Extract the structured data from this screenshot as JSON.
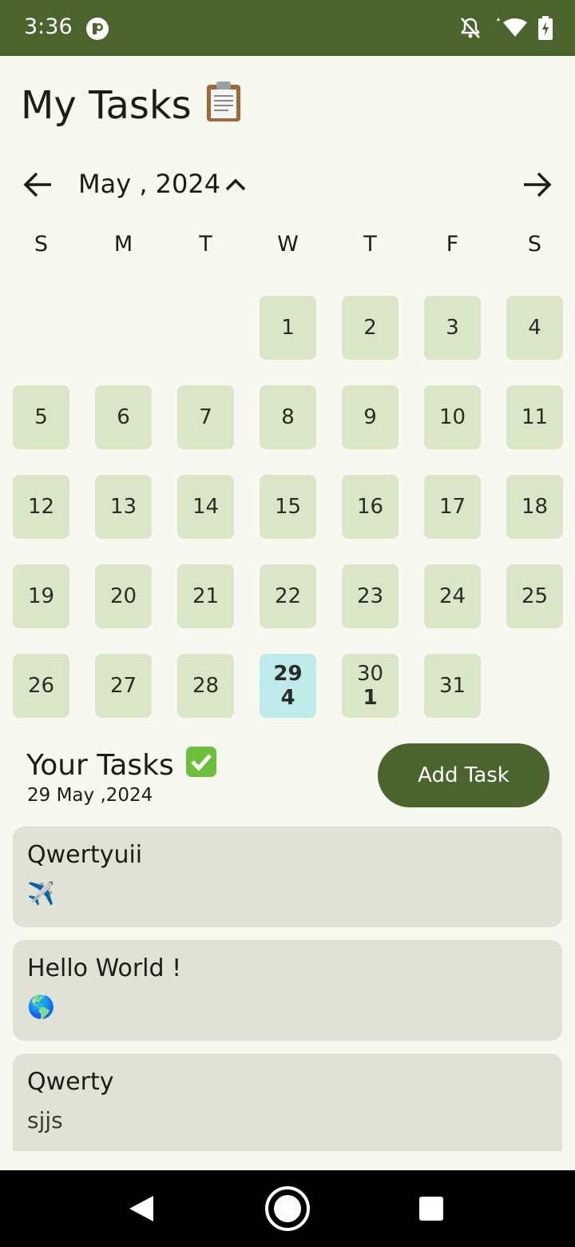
{
  "status_bar": {
    "time": "3:36"
  },
  "header": {
    "title": "My Tasks",
    "title_icon": "clipboard-icon"
  },
  "calendar": {
    "month_label": "May , 2024",
    "weekdays": [
      "S",
      "M",
      "T",
      "W",
      "T",
      "F",
      "S"
    ],
    "days": [
      {
        "day": "1"
      },
      {
        "day": "2"
      },
      {
        "day": "3"
      },
      {
        "day": "4"
      },
      {
        "day": "5"
      },
      {
        "day": "6"
      },
      {
        "day": "7"
      },
      {
        "day": "8"
      },
      {
        "day": "9"
      },
      {
        "day": "10"
      },
      {
        "day": "11"
      },
      {
        "day": "12"
      },
      {
        "day": "13"
      },
      {
        "day": "14"
      },
      {
        "day": "15"
      },
      {
        "day": "16"
      },
      {
        "day": "17"
      },
      {
        "day": "18"
      },
      {
        "day": "19"
      },
      {
        "day": "20"
      },
      {
        "day": "21"
      },
      {
        "day": "22"
      },
      {
        "day": "23"
      },
      {
        "day": "24"
      },
      {
        "day": "25"
      },
      {
        "day": "26"
      },
      {
        "day": "27"
      },
      {
        "day": "28"
      },
      {
        "day": "29",
        "count": "4",
        "selected": true
      },
      {
        "day": "30",
        "count": "1"
      },
      {
        "day": "31"
      }
    ]
  },
  "tasks_section": {
    "heading": "Your Tasks",
    "heading_icon": "check-mark-icon",
    "date": "29 May ,2024",
    "add_button_label": "Add Task"
  },
  "tasks": [
    {
      "title": "Qwertyuii",
      "description": "✈️"
    },
    {
      "title": "Hello World !",
      "description": "🌎"
    },
    {
      "title": "Qwerty",
      "description": "sjjs"
    }
  ],
  "colors": {
    "primary": "#4b632c",
    "day_bg": "#dbe6c9",
    "selected_day_bg": "#bfeaea",
    "card_bg": "#e0e2d6",
    "page_bg": "#f7f8f0"
  }
}
